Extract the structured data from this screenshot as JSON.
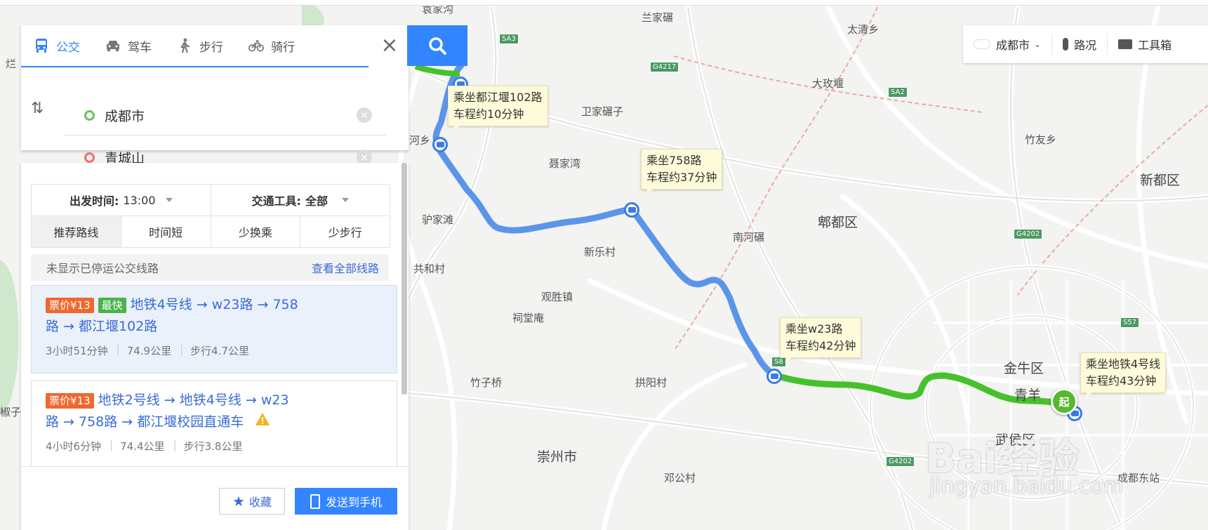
{
  "travel_modes": [
    {
      "label": "公交",
      "icon": "bus-icon",
      "active": true
    },
    {
      "label": "驾车",
      "icon": "car-icon",
      "active": false
    },
    {
      "label": "步行",
      "icon": "walk-icon",
      "active": false
    },
    {
      "label": "骑行",
      "icon": "bike-icon",
      "active": false
    }
  ],
  "origin": "成都市",
  "destination": "青城山",
  "filters": {
    "depart_label": "出发时间:",
    "depart_value": "13:00",
    "vehicle_label": "交通工具:",
    "vehicle_value": "全部",
    "sort_options": [
      "推荐路线",
      "时间短",
      "少换乘",
      "少步行"
    ],
    "active_sort": "推荐路线"
  },
  "notice": {
    "text": "未显示已停运公交线路",
    "link": "查看全部线路"
  },
  "routes": [
    {
      "price": "票价¥13",
      "tag": "最快",
      "line1": "地铁4号线 → w23路 → 758",
      "line2": "路 → 都江堰102路",
      "duration": "3小时51分钟",
      "distance": "74.9公里",
      "walk": "步行4.7公里"
    },
    {
      "price": "票价¥13",
      "line1": "地铁2号线 → 地铁4号线 → w23",
      "line2": "路 → 758路 → 都江堰校园直通车",
      "duration": "4小时6分钟",
      "distance": "74.4公里",
      "walk": "步行3.8公里"
    }
  ],
  "footer": {
    "fav": "收藏",
    "send": "发送到手机"
  },
  "toolbar": {
    "city": "成都市",
    "traffic": "路况",
    "tools": "工具箱"
  },
  "tips": [
    {
      "line1": "乘坐都江堰102路",
      "line2": "车程约10分钟"
    },
    {
      "line1": "乘坐758路",
      "line2": "车程约37分钟"
    },
    {
      "line1": "乘坐w23路",
      "line2": "车程约42分钟"
    },
    {
      "line1": "乘坐地铁4号线",
      "line2": "车程约43分钟"
    }
  ],
  "start_marker": "起",
  "place_labels": [
    "袁家沟",
    "兰家碾",
    "太清乡",
    "大玫堰",
    "卫家碾子",
    "竹友乡",
    "聂家湾",
    "新都区",
    "驴家滩",
    "郫都区",
    "南河碾",
    "新乐村",
    "共和村",
    "观胜镇",
    "祠堂庵",
    "竹子桥",
    "拱阳村",
    "金牛区",
    "青羊",
    "崇州市",
    "邓公村",
    "成都东站",
    "武侯区",
    "河乡",
    "烂",
    "椒子"
  ],
  "road_shields": [
    "SA3",
    "G4217",
    "SA2",
    "G4202",
    "S57",
    "S8",
    "G4202"
  ],
  "watermark": {
    "logo": "Bai经验",
    "url": "jingyan.baidu.com"
  },
  "colors": {
    "accent": "#3385ff",
    "transit_line": "#5b95ea",
    "subway_line": "#45c22b",
    "price_badge": "#f0682f",
    "fast_badge": "#49b34c"
  }
}
